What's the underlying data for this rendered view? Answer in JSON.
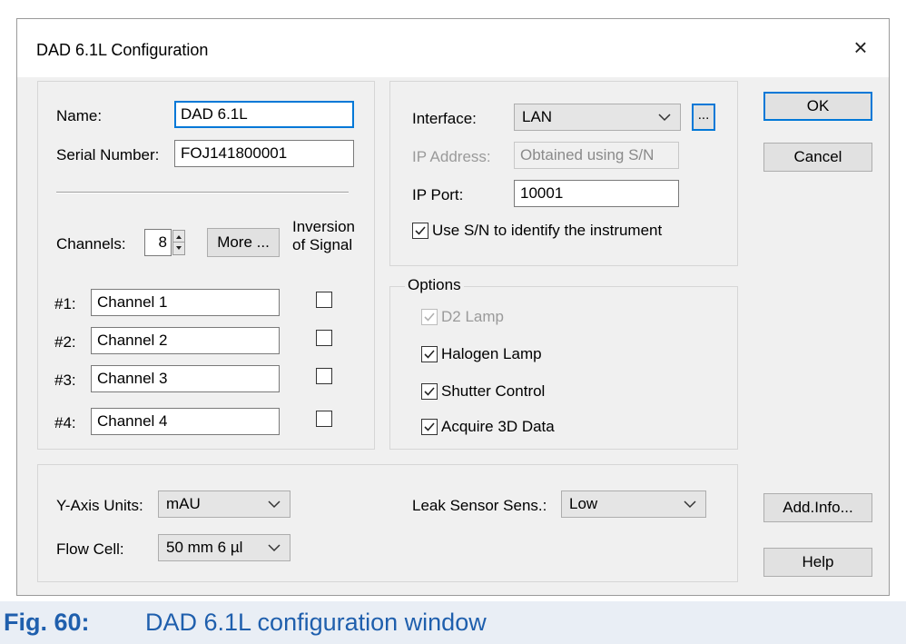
{
  "dialog": {
    "title": "DAD 6.1L Configuration",
    "close_glyph": "×"
  },
  "general": {
    "name_label": "Name:",
    "name_value": "DAD 6.1L",
    "serial_label": "Serial Number:",
    "serial_value": "FOJ141800001"
  },
  "channels": {
    "label": "Channels:",
    "count": "8",
    "more_label": "More ...",
    "inversion_label_line1": "Inversion",
    "inversion_label_line2": "of Signal",
    "rows": [
      {
        "index": "#1:",
        "name": "Channel 1",
        "inverted": false
      },
      {
        "index": "#2:",
        "name": "Channel 2",
        "inverted": false
      },
      {
        "index": "#3:",
        "name": "Channel 3",
        "inverted": false
      },
      {
        "index": "#4:",
        "name": "Channel 4",
        "inverted": false
      }
    ]
  },
  "connection": {
    "interface_label": "Interface:",
    "interface_value": "LAN",
    "browse_label": "...",
    "ip_address_label": "IP Address:",
    "ip_address_value": "Obtained using S/N",
    "ip_port_label": "IP Port:",
    "ip_port_value": "10001",
    "use_sn_label": "Use S/N to identify the instrument",
    "use_sn_checked": true
  },
  "options": {
    "title": "Options",
    "items": [
      {
        "label": "D2 Lamp",
        "checked": true,
        "disabled": true
      },
      {
        "label": "Halogen Lamp",
        "checked": true,
        "disabled": false
      },
      {
        "label": "Shutter Control",
        "checked": true,
        "disabled": false
      },
      {
        "label": "Acquire 3D Data",
        "checked": true,
        "disabled": false
      }
    ]
  },
  "bottom": {
    "y_axis_label": "Y-Axis Units:",
    "y_axis_value": "mAU",
    "flow_cell_label": "Flow Cell:",
    "flow_cell_value": "50 mm 6 µl",
    "leak_label": "Leak Sensor Sens.:",
    "leak_value": "Low"
  },
  "buttons": {
    "ok": "OK",
    "cancel": "Cancel",
    "add_info": "Add.Info...",
    "help": "Help"
  },
  "caption": {
    "number": "Fig. 60:",
    "text": "DAD 6.1L configuration window"
  },
  "colors": {
    "accent": "#0078d7",
    "dialog_bg": "#f0f0f0",
    "caption_text": "#1f5fad",
    "caption_bg": "#e9eef5"
  },
  "icons": {
    "close": "close-icon",
    "dropdown": "chevron-down-icon",
    "checkmark": "checkmark-icon",
    "spin_up": "arrow-up-icon",
    "spin_down": "arrow-down-icon"
  }
}
